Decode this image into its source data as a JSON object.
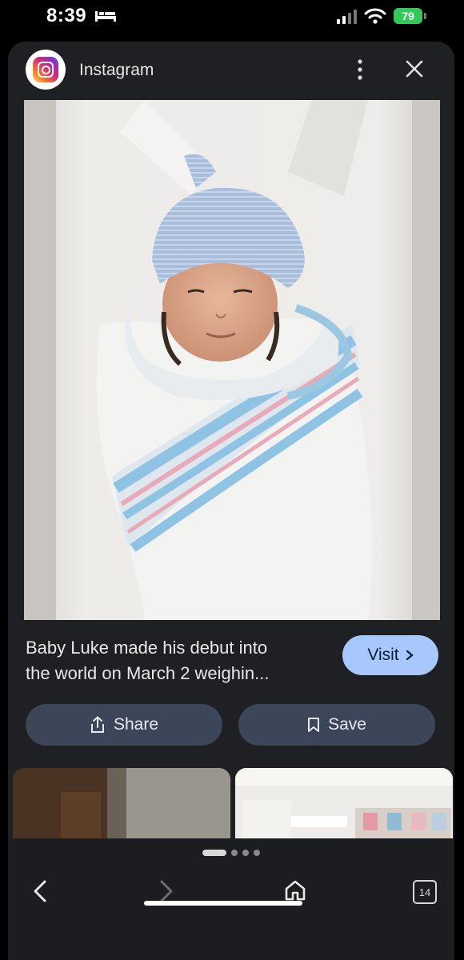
{
  "status_bar": {
    "time": "8:39",
    "battery": "79",
    "icons": [
      "sleep-focus-icon",
      "cellular-signal-icon",
      "wifi-icon",
      "battery-icon"
    ]
  },
  "header": {
    "source_name": "Instagram",
    "icons": [
      "instagram-logo-icon",
      "more-vertical-icon",
      "close-icon"
    ]
  },
  "image": {
    "subject": "newborn baby in knit hat swaddled in striped hospital blanket"
  },
  "result": {
    "caption_line1": "Baby Luke made his debut into",
    "caption_line2": "the world on March 2 weighin...",
    "visit_label": "Visit"
  },
  "actions": {
    "share_label": "Share",
    "save_label": "Save"
  },
  "pager": {
    "pages": 4,
    "active": 0
  },
  "nav": {
    "tab_count": "14",
    "icons": [
      "back-icon",
      "forward-icon",
      "home-icon",
      "tabs-icon"
    ]
  },
  "colors": {
    "sheet_bg": "#1f2024",
    "visit_button": "#a8c7fa",
    "action_button": "#3c4658",
    "battery": "#34c759"
  }
}
